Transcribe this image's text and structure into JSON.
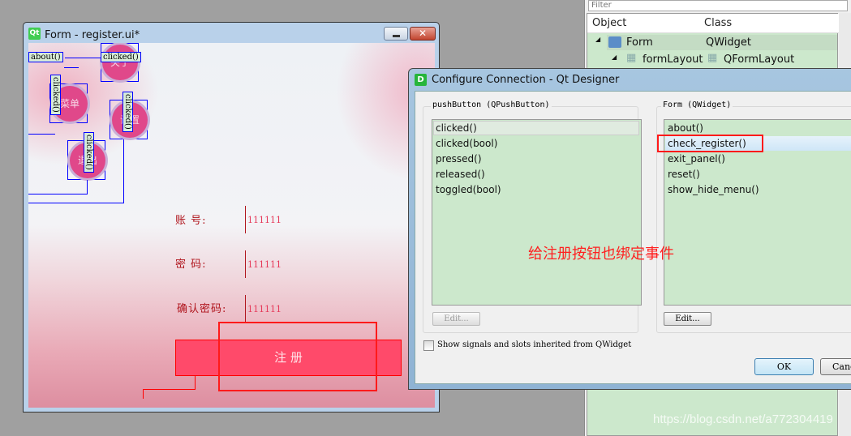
{
  "form_window": {
    "title": "Form - register.ui*",
    "logo": "Qt",
    "round_buttons": [
      {
        "label": "关于",
        "slot": "clicked()"
      },
      {
        "label": "菜单",
        "slot": "clicked()"
      },
      {
        "label": "设置",
        "slot": "clicked()"
      },
      {
        "label": "退出",
        "slot": "clicked()"
      }
    ],
    "about_slot": "about()",
    "fields": [
      {
        "label": "账      号:",
        "value": "111111"
      },
      {
        "label": "密      码:",
        "value": "111111"
      },
      {
        "label": "确认密码:",
        "value": "111111"
      }
    ],
    "register_button": "注      册"
  },
  "object_inspector": {
    "filter_placeholder": "Filter",
    "columns": [
      "Object",
      "Class"
    ],
    "rows": [
      {
        "object": "Form",
        "class": "QWidget"
      },
      {
        "object": "formLayout",
        "class": "QFormLayout"
      }
    ]
  },
  "dialog": {
    "logo": "D",
    "title": "Configure Connection - Qt Designer",
    "left_group": "pushButton (QPushButton)",
    "signals": [
      "clicked()",
      "clicked(bool)",
      "pressed()",
      "released()",
      "toggled(bool)"
    ],
    "selected_signal": "clicked()",
    "right_group": "Form (QWidget)",
    "slots": [
      "about()",
      "check_register()",
      "exit_panel()",
      "reset()",
      "show_hide_menu()"
    ],
    "selected_slot": "check_register()",
    "edit_label": "Edit...",
    "inherited_checkbox": {
      "label": "Show signals and slots inherited from QWidget",
      "checked": false
    },
    "ok_label": "OK",
    "cancel_label": "Cancel"
  },
  "annotation": {
    "text": "给注册按钮也绑定事件",
    "color": "#ff2020"
  },
  "watermark": "https://blog.csdn.net/a772304419"
}
